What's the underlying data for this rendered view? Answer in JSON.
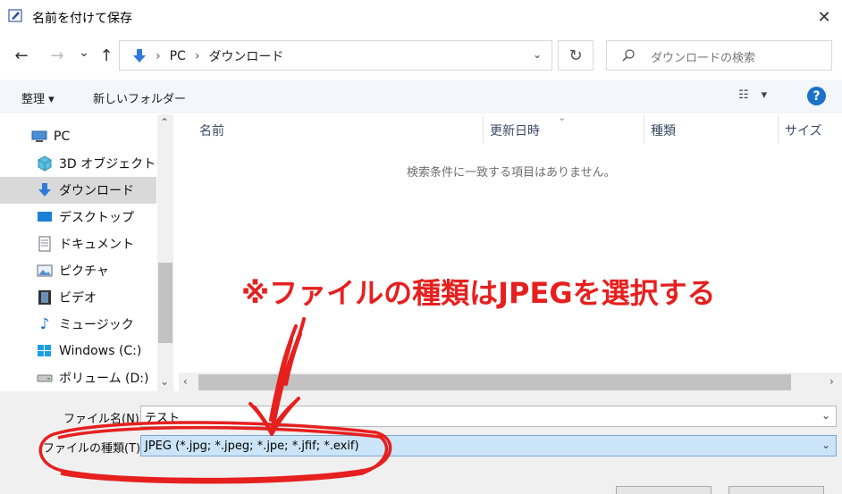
{
  "window": {
    "title": "名前を付けて保存",
    "close_glyph": "✕"
  },
  "nav": {
    "back_glyph": "←",
    "forward_glyph": "→",
    "recent_glyph": "⌄",
    "up_glyph": "↑",
    "breadcrumb": [
      "PC",
      "ダウンロード"
    ],
    "breadcrumb_sep": "›",
    "refresh_glyph": "↻",
    "search_placeholder": "ダウンロードの検索"
  },
  "commandbar": {
    "organize_label": "整理 ▾",
    "new_folder_label": "新しいフォルダー",
    "view_glyph": "☷",
    "view_dropdown_glyph": "▾",
    "help_label": "?"
  },
  "sidebar": {
    "items": [
      {
        "label": "PC",
        "icon": "pc-icon"
      },
      {
        "label": "3D オブジェクト",
        "icon": "cube-icon"
      },
      {
        "label": "ダウンロード",
        "icon": "download-icon",
        "selected": true
      },
      {
        "label": "デスクトップ",
        "icon": "desktop-icon"
      },
      {
        "label": "ドキュメント",
        "icon": "document-icon"
      },
      {
        "label": "ピクチャ",
        "icon": "picture-icon"
      },
      {
        "label": "ビデオ",
        "icon": "video-icon"
      },
      {
        "label": "ミュージック",
        "icon": "music-icon"
      },
      {
        "label": "Windows (C:)",
        "icon": "windows-drive-icon"
      },
      {
        "label": "ボリューム (D:)",
        "icon": "drive-icon"
      }
    ]
  },
  "filelist": {
    "columns": [
      "名前",
      "更新日時",
      "種類",
      "サイズ"
    ],
    "empty_message": "検索条件に一致する項目はありません。"
  },
  "annotation": {
    "text": "※ファイルの種類はJPEGを選択する",
    "color": "#e6201f"
  },
  "form": {
    "filename_label": "ファイル名(N):",
    "filename_value": "テスト",
    "filetype_label": "ファイルの種類(T):",
    "filetype_value": "JPEG (*.jpg; *.jpeg; *.jpe; *.jfif; *.exif)"
  },
  "colors": {
    "accent": "#1a73c8",
    "selection": "#cce4f7",
    "annotation_red": "#e6201f"
  }
}
